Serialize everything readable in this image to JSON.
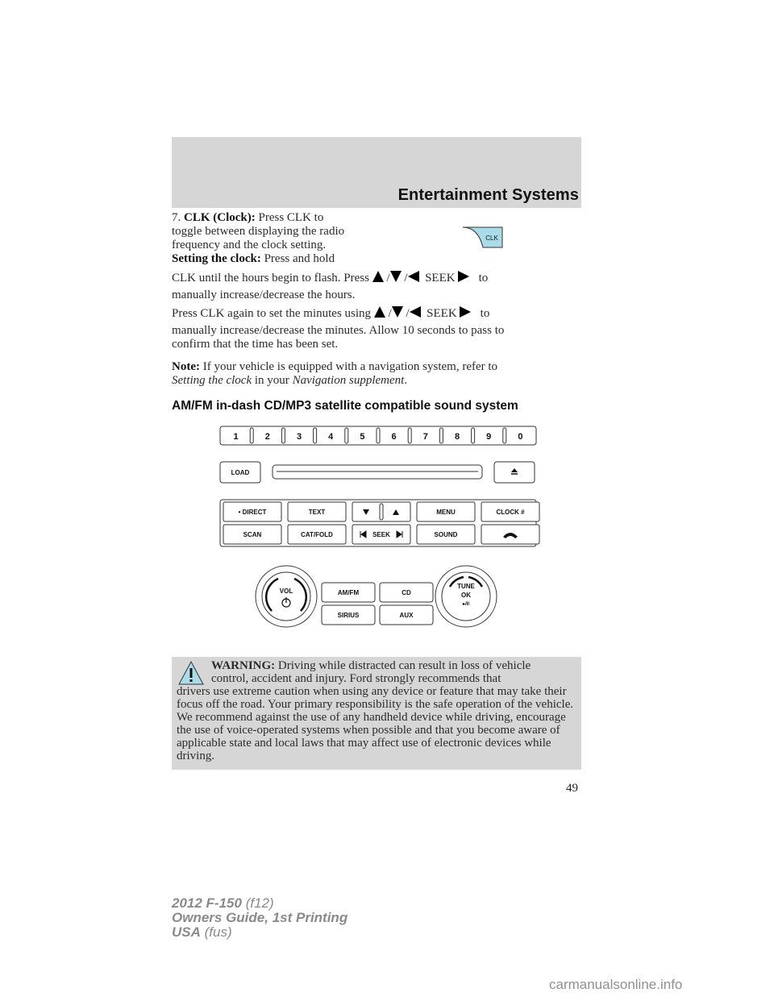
{
  "header": {
    "section_title": "Entertainment Systems"
  },
  "clk_section": {
    "item_number": "7.",
    "item_label": "CLK (Clock):",
    "item_text_1": "Press CLK to",
    "item_text_2": "toggle between displaying the radio",
    "item_text_3": "frequency and the clock setting.",
    "clk_icon_label": "CLK",
    "setting_label": "Setting the clock:",
    "setting_text": "Press and hold",
    "hours_line_a": "CLK until the hours begin to flash. Press",
    "seek_label": "SEEK",
    "to_word": "to",
    "slash": "/",
    "hours_line_b": "manually increase/decrease the hours.",
    "minutes_line_a": "Press CLK again to set the minutes using",
    "minutes_line_b": "manually increase/decrease the minutes. Allow 10 seconds to pass to",
    "minutes_line_c": "confirm that the time has been set.",
    "note_label": "Note:",
    "note_text": "If your vehicle is equipped with a navigation system, refer to",
    "note_italic_1": "Setting the clock",
    "note_mid": "in your",
    "note_italic_2": "Navigation supplement",
    "note_end": "."
  },
  "sound_system": {
    "heading": "AM/FM in-dash CD/MP3 satellite compatible sound system",
    "preset_buttons": [
      "1",
      "2",
      "3",
      "4",
      "5",
      "6",
      "7",
      "8",
      "9",
      "0"
    ],
    "load_button": "LOAD",
    "eject_symbol": "⏏",
    "upper_row": [
      "• DIRECT",
      "TEXT",
      "",
      "MENU",
      "CLOCK #"
    ],
    "lower_row": [
      "SCAN",
      "CAT/FOLD",
      "SEEK",
      "SOUND",
      ""
    ],
    "vol_label": "VOL",
    "source_buttons": [
      "AM/FM",
      "CD",
      "SIRIUS",
      "AUX"
    ],
    "tune_label": "TUNE",
    "ok_label": "OK",
    "play_pause_label": "▸/II"
  },
  "warning": {
    "label": "WARNING:",
    "line1": "Driving while distracted can result in loss of vehicle",
    "line2": "control, accident and injury. Ford strongly recommends that",
    "rest": "drivers use extreme caution when using any device or feature that may take their focus off the road. Your primary responsibility is the safe operation of the vehicle. We recommend against the use of any handheld device while driving, encourage the use of voice-operated systems when possible and that you become aware of applicable state and local laws that may affect use of electronic devices while driving."
  },
  "page_number": "49",
  "footer": {
    "line1_bold": "2012 F-150",
    "line1_light": "(f12)",
    "line2_bold": "Owners Guide, 1st Printing",
    "line3_bold": "USA",
    "line3_light": "(fus)"
  },
  "watermark": "carmanualsonline.info",
  "colors": {
    "header_band": "#d6d6d6",
    "icon_fill": "#a9dce8",
    "footer_gray": "#8a8a8a"
  }
}
